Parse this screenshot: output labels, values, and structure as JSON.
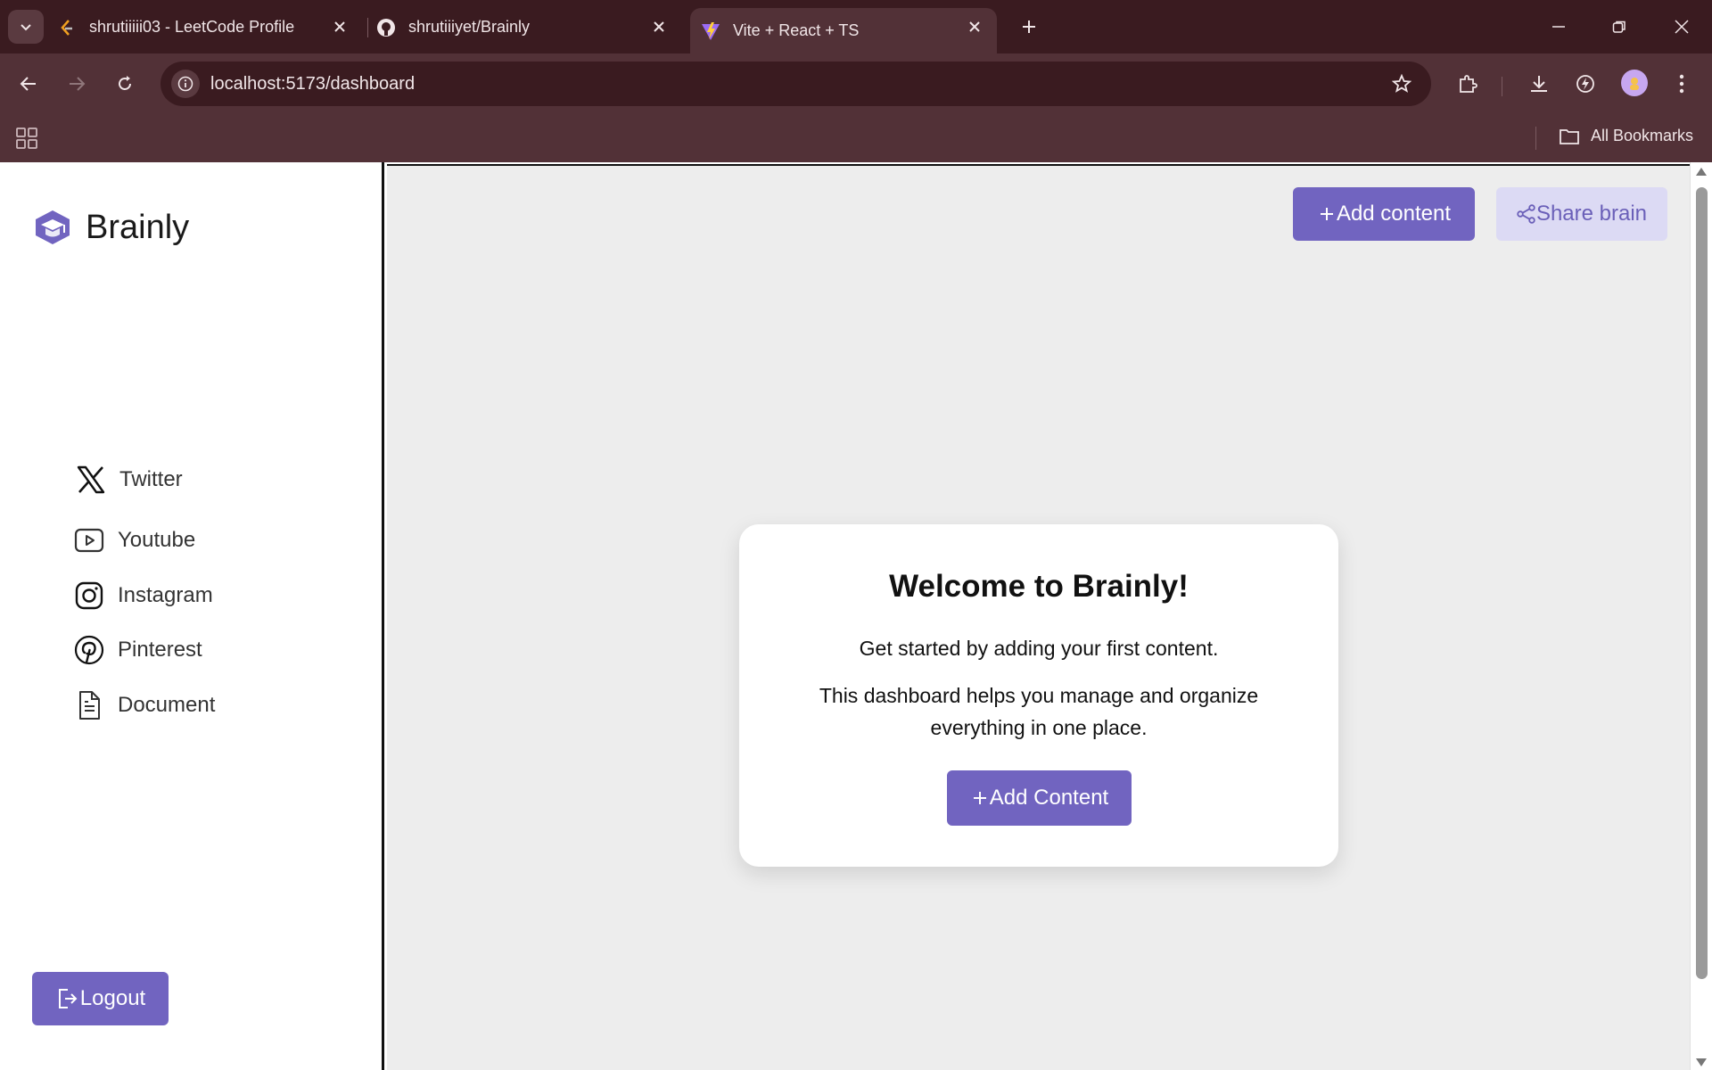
{
  "browser": {
    "tabs": [
      {
        "title": "shrutiiiii03 - LeetCode Profile",
        "favicon": "leetcode-icon"
      },
      {
        "title": "shrutiiiyet/Brainly",
        "favicon": "github-icon"
      },
      {
        "title": "Vite + React + TS",
        "favicon": "vite-icon",
        "active": true
      }
    ],
    "url": "localhost:5173/dashboard",
    "bookmarks_label": "All Bookmarks"
  },
  "sidebar": {
    "brand": "Brainly",
    "items": [
      {
        "label": "Twitter",
        "icon": "x-twitter-icon"
      },
      {
        "label": "Youtube",
        "icon": "youtube-icon"
      },
      {
        "label": "Instagram",
        "icon": "instagram-icon"
      },
      {
        "label": "Pinterest",
        "icon": "pinterest-icon"
      },
      {
        "label": "Document",
        "icon": "document-icon"
      }
    ],
    "logout_label": "Logout"
  },
  "header": {
    "add_content_label": "Add content",
    "share_brain_label": "Share brain"
  },
  "welcome": {
    "title": "Welcome to Brainly!",
    "line1": "Get started by adding your first content.",
    "line2": "This dashboard helps you manage and organize everything in one place.",
    "button_label": "Add Content"
  },
  "colors": {
    "accent": "#7164c0",
    "accent_light": "#dcdaf4",
    "main_bg": "#ededed",
    "chrome_bg": "#523137"
  }
}
